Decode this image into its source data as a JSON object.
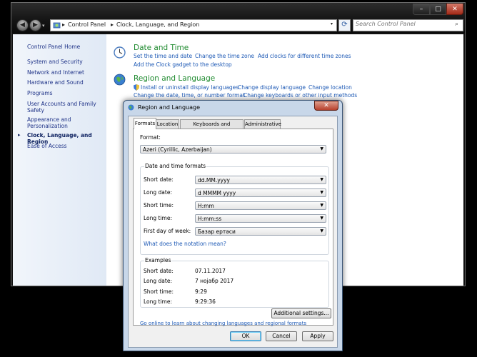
{
  "address": {
    "crumbs": [
      "Control Panel",
      "Clock, Language, and Region"
    ],
    "search_placeholder": "Search Control Panel"
  },
  "window_buttons": {
    "minimize": "–",
    "maximize": "□",
    "close": "✕"
  },
  "sidebar": {
    "items": [
      "Control Panel Home",
      "System and Security",
      "Network and Internet",
      "Hardware and Sound",
      "Programs",
      "User Accounts and Family Safety",
      "Appearance and Personalization",
      "Clock, Language, and Region",
      "Ease of Access"
    ]
  },
  "categories": {
    "datetime": {
      "title": "Date and Time",
      "links": [
        "Set the time and date",
        "Change the time zone",
        "Add clocks for different time zones",
        "Add the Clock gadget to the desktop"
      ]
    },
    "region": {
      "title": "Region and Language",
      "links": [
        "Install or uninstall display languages",
        "Change display language",
        "Change location",
        "Change the date, time, or number format",
        "Change keyboards or other input methods"
      ]
    }
  },
  "dialog": {
    "title": "Region and Language",
    "tabs": [
      "Formats",
      "Location",
      "Keyboards and Languages",
      "Administrative"
    ],
    "format_label": "Format:",
    "format_value": "Azeri (Cyrillic, Azerbaijan)",
    "dt_group_title": "Date and time formats",
    "fields": [
      {
        "label": "Short date:",
        "value": "dd.MM.yyyy"
      },
      {
        "label": "Long date:",
        "value": "d MMMM yyyy"
      },
      {
        "label": "Short time:",
        "value": "H:mm"
      },
      {
        "label": "Long time:",
        "value": "H:mm:ss"
      },
      {
        "label": "First day of week:",
        "value": "Базар ертәси"
      }
    ],
    "notation_link": "What does the notation mean?",
    "examples_title": "Examples",
    "examples": [
      {
        "label": "Short date:",
        "value": "07.11.2017"
      },
      {
        "label": "Long date:",
        "value": "7 нојабр 2017"
      },
      {
        "label": "Short time:",
        "value": "9:29"
      },
      {
        "label": "Long time:",
        "value": "9:29:36"
      }
    ],
    "additional_button": "Additional settings...",
    "online_link": "Go online to learn about changing languages and regional formats",
    "ok": "OK",
    "cancel": "Cancel",
    "apply": "Apply"
  }
}
